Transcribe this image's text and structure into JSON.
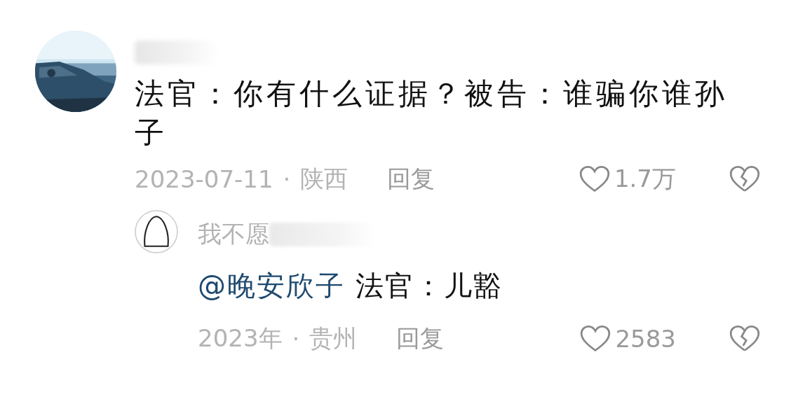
{
  "comment": {
    "text": "法官：你有什么证据？被告：谁骗你谁孙子",
    "date": "2023-07-11",
    "separator": "·",
    "location": "陕西",
    "reply_label": "回复",
    "likes": "1.7万",
    "liked": false,
    "replies": [
      {
        "author": "我不愿",
        "mention": "@晚安欣子",
        "text": "法官：儿豁",
        "date": "2023年",
        "separator": "·",
        "location": "贵州",
        "reply_label": "回复",
        "likes": "2583",
        "liked": false
      }
    ]
  }
}
